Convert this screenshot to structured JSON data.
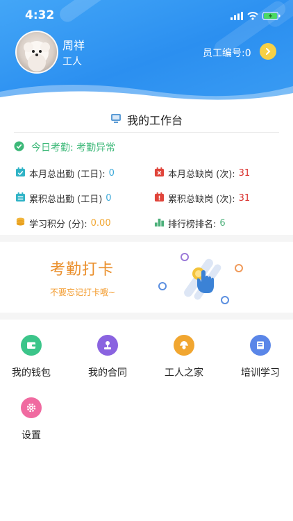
{
  "status": {
    "time": "4:32"
  },
  "profile": {
    "name": "周祥",
    "role": "工人",
    "employee_label": "员工编号:0"
  },
  "workbench": {
    "title": "我的工作台"
  },
  "attendance": {
    "label": "今日考勤:",
    "value": "考勤异常"
  },
  "stats": {
    "month_attendance": {
      "label": "本月总出勤 (工日):",
      "value": "0"
    },
    "month_absence": {
      "label": "本月总缺岗 (次):",
      "value": "31"
    },
    "total_attendance": {
      "label": "累积总出勤 (工日)",
      "value": "0"
    },
    "total_absence": {
      "label": "累积总缺岗 (次):",
      "value": "31"
    },
    "points": {
      "label": "学习积分 (分):",
      "value": "0.00"
    },
    "ranking": {
      "label": "排行榜排名:",
      "value": "6"
    }
  },
  "punch": {
    "title": "考勤打卡",
    "subtitle": "不要忘记打卡哦~"
  },
  "menu": [
    {
      "label": "我的钱包",
      "icon": "wallet-icon",
      "color": "#3cc58a"
    },
    {
      "label": "我的合同",
      "icon": "contract-icon",
      "color": "#8a63e0"
    },
    {
      "label": "工人之家",
      "icon": "worker-icon",
      "color": "#f1a630"
    },
    {
      "label": "培训学习",
      "icon": "book-icon",
      "color": "#5a86e8"
    },
    {
      "label": "设置",
      "icon": "gear-icon",
      "color": "#f06aa0"
    }
  ],
  "colors": {
    "header": "#2b8ff0",
    "positive": "#3cb878",
    "negative": "#d9302c",
    "accent": "#ea8f2c"
  }
}
